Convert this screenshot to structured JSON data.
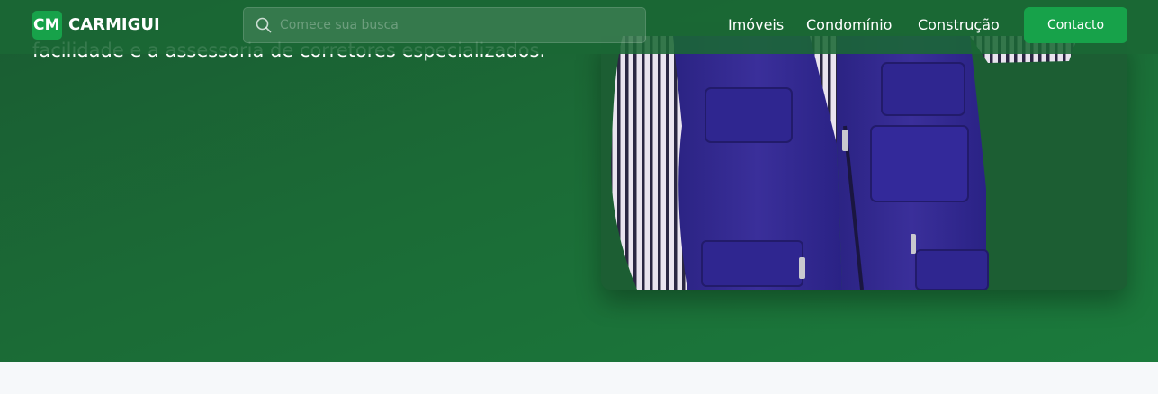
{
  "brand": {
    "badge": "CM",
    "name": "CARMIGUI",
    "accent_color": "#17a24a"
  },
  "search": {
    "placeholder": "Comece sua busca",
    "value": "",
    "icon": "search-icon"
  },
  "nav": {
    "links": [
      {
        "label": "Imóveis"
      },
      {
        "label": "Condomínio"
      },
      {
        "label": "Construção"
      }
    ],
    "contact_label": "Contacto"
  },
  "hero": {
    "subtitle": "facilidade e a assessoria de corretores especializados.",
    "background_color": "#1b6b36",
    "image": "photo-worker-vest"
  }
}
